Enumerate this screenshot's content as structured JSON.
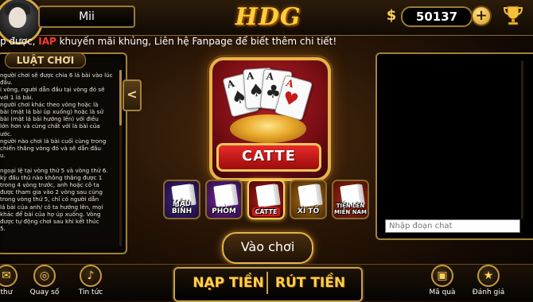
{
  "header": {
    "username": "Mii",
    "logo_text": "HDG",
    "balance": "50137",
    "plus_label": "+",
    "currency_symbol": "$"
  },
  "marquee": {
    "text_before": "p được, ",
    "highlight": "IAP",
    "text_after": " khuyến mãi khủng, Liên hệ Fanpage để biết thêm chi tiết!"
  },
  "rules": {
    "title": "LUẬT CHƠI",
    "text": "người chơi sẽ được chia 6 lá bài vào lúc\nđầu.\ni vòng, người dẫn đầu tại vòng đó sẽ\nvới 1 lá bài.\nngười chơi khác theo vòng hoặc là\nbài (mặt lá bài úp xuống) hoặc là sử\nbài (mặt lá bài hướng lên) với điều\nlớn hơn và cùng chất với lá bài của\nước.\nngười nào chơi lá bài cuối cùng trong\nchiến thắng vòng đó và sẽ dẫn đầu\nu.\n\nngoại lệ tại vòng thứ 5 và vòng thứ 6.\nkỳ đấu thủ nào không thắng được 1\ntrong 4 vòng trước, anh hoặc cô ta\nđược tham gia vào 2 vòng sau cùng\ntrong vòng thứ 5, chỉ có người dẫn\nlá bài của anh/ cô ta hướng lên, mọi\nkhác để bài của họ úp xuống. Vòng\nđược tự động chơi sau khi kết thúc\n5.",
    "arrow": "<"
  },
  "featured_game": {
    "name": "CATTE"
  },
  "games": [
    {
      "label": "MẬU BINH"
    },
    {
      "label": "PHỎM"
    },
    {
      "label": "CATTE"
    },
    {
      "label": "XÌ TỐ"
    },
    {
      "label": "TIẾN LÊN MIỀN NAM"
    }
  ],
  "play_button": "Vào chơi",
  "chat": {
    "placeholder": "Nhập đoạn chat"
  },
  "bottom_nav": {
    "left": [
      {
        "label": "thư",
        "icon": "mail-icon"
      },
      {
        "label": "Quay số",
        "icon": "wheel-icon"
      },
      {
        "label": "Tin tức",
        "icon": "bell-icon"
      }
    ],
    "right": [
      {
        "label": "Mã quà",
        "icon": "gift-icon"
      },
      {
        "label": "Đánh giá",
        "icon": "star-icon"
      }
    ]
  },
  "deposit_label": "NẠP TIỀN",
  "withdraw_label": "RÚT TIỀN",
  "colors": {
    "gold": "#e4b34a",
    "accent_red": "#ff3b2f",
    "catte_red": "#c81e1e"
  }
}
